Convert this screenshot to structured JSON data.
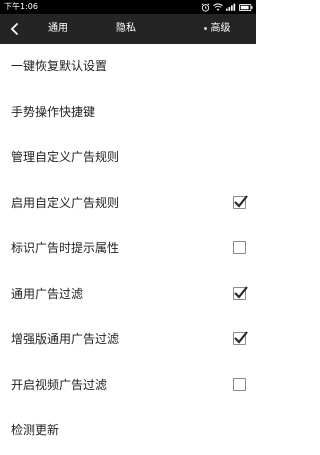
{
  "status_bar": {
    "time": "下午1:06",
    "icons": [
      "alarm-icon",
      "wifi-icon",
      "signal-icon",
      "battery-icon"
    ]
  },
  "header": {
    "back_icon": "back-arrow-icon",
    "tabs": [
      {
        "label": "通用",
        "selected": false
      },
      {
        "label": "隐私",
        "selected": false
      },
      {
        "label": "高级",
        "selected": true
      }
    ]
  },
  "settings": {
    "items": [
      {
        "label": "一键恢复默认设置",
        "has_checkbox": false
      },
      {
        "label": "手势操作快捷键",
        "has_checkbox": false
      },
      {
        "label": "管理自定义广告规则",
        "has_checkbox": false
      },
      {
        "label": "启用自定义广告规则",
        "has_checkbox": true,
        "checked": true
      },
      {
        "label": "标识广告时提示属性",
        "has_checkbox": true,
        "checked": false
      },
      {
        "label": "通用广告过滤",
        "has_checkbox": true,
        "checked": true
      },
      {
        "label": "增强版通用广告过滤",
        "has_checkbox": true,
        "checked": true
      },
      {
        "label": "开启视频广告过滤",
        "has_checkbox": true,
        "checked": false
      },
      {
        "label": "检测更新",
        "has_checkbox": false
      }
    ]
  },
  "colors": {
    "status_bar": "#000000",
    "top_bar": "#242424",
    "background": "#ffffff",
    "text": "#1f1f1f",
    "checkbox_border": "#8a8a8a",
    "checkmark": "#2b2b2b"
  }
}
